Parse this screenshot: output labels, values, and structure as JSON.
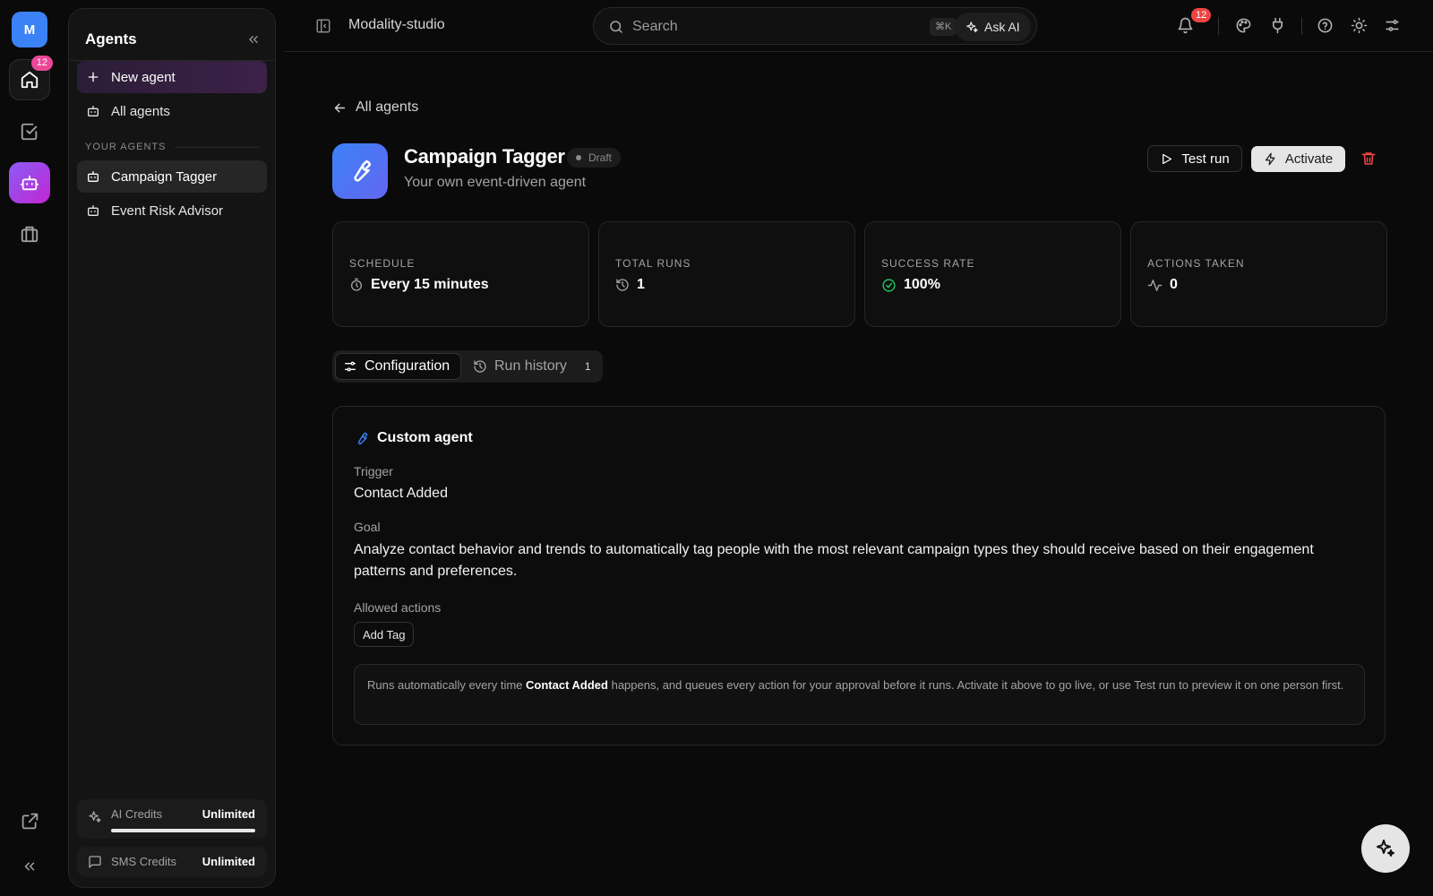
{
  "rail": {
    "workspace_initial": "M",
    "home_badge": "12",
    "icons": [
      "home-icon",
      "checkbox-icon",
      "bot-icon",
      "briefcase-icon",
      "external-link-icon",
      "chevrons-left-icon"
    ]
  },
  "sidebar": {
    "title": "Agents",
    "new_agent": "New agent",
    "all_agents": "All agents",
    "section": "YOUR AGENTS",
    "agents": [
      {
        "label": "Campaign Tagger"
      },
      {
        "label": "Event Risk Advisor"
      }
    ],
    "credits": {
      "ai_label": "AI Credits",
      "ai_value": "Unlimited",
      "ai_level": 1.0,
      "sms_label": "SMS Credits",
      "sms_value": "Unlimited"
    }
  },
  "topbar": {
    "workspace": "Modality-studio",
    "search_placeholder": "Search",
    "shortcut": "⌘K",
    "ask_ai": "Ask AI",
    "notif_count": "12"
  },
  "agent": {
    "back_label": "All agents",
    "title": "Campaign Tagger",
    "status": "Draft",
    "subtitle": "Your own event-driven agent",
    "test_run": "Test run",
    "activate": "Activate"
  },
  "stats": [
    {
      "label": "SCHEDULE",
      "value": "Every 15 minutes",
      "icon": "timer-icon"
    },
    {
      "label": "TOTAL RUNS",
      "value": "1",
      "icon": "history-icon"
    },
    {
      "label": "SUCCESS RATE",
      "value": "100%",
      "icon": "check-circle-icon"
    },
    {
      "label": "ACTIONS TAKEN",
      "value": "0",
      "icon": "activity-icon"
    }
  ],
  "tabs": {
    "configuration": "Configuration",
    "run_history": "Run history",
    "run_history_count": "1"
  },
  "config": {
    "card_title": "Custom agent",
    "trigger_label": "Trigger",
    "trigger_value": "Contact Added",
    "goal_label": "Goal",
    "goal_value": "Analyze contact behavior and trends to automatically tag people with the most relevant campaign types they should receive based on their engagement patterns and preferences.",
    "allowed_label": "Allowed actions",
    "allowed_actions": [
      "Add Tag"
    ],
    "info_pre": "Runs automatically every time ",
    "info_bold": "Contact Added",
    "info_post": " happens, and queues every action for your approval before it runs. Activate it above to go live, or use Test run to preview it on one person first."
  },
  "colors": {
    "accent_blue": "#3b82f6",
    "accent_purple": "#8b5cf6",
    "badge_pink": "#ec4899",
    "danger": "#ef4444",
    "success": "#22c55e"
  }
}
